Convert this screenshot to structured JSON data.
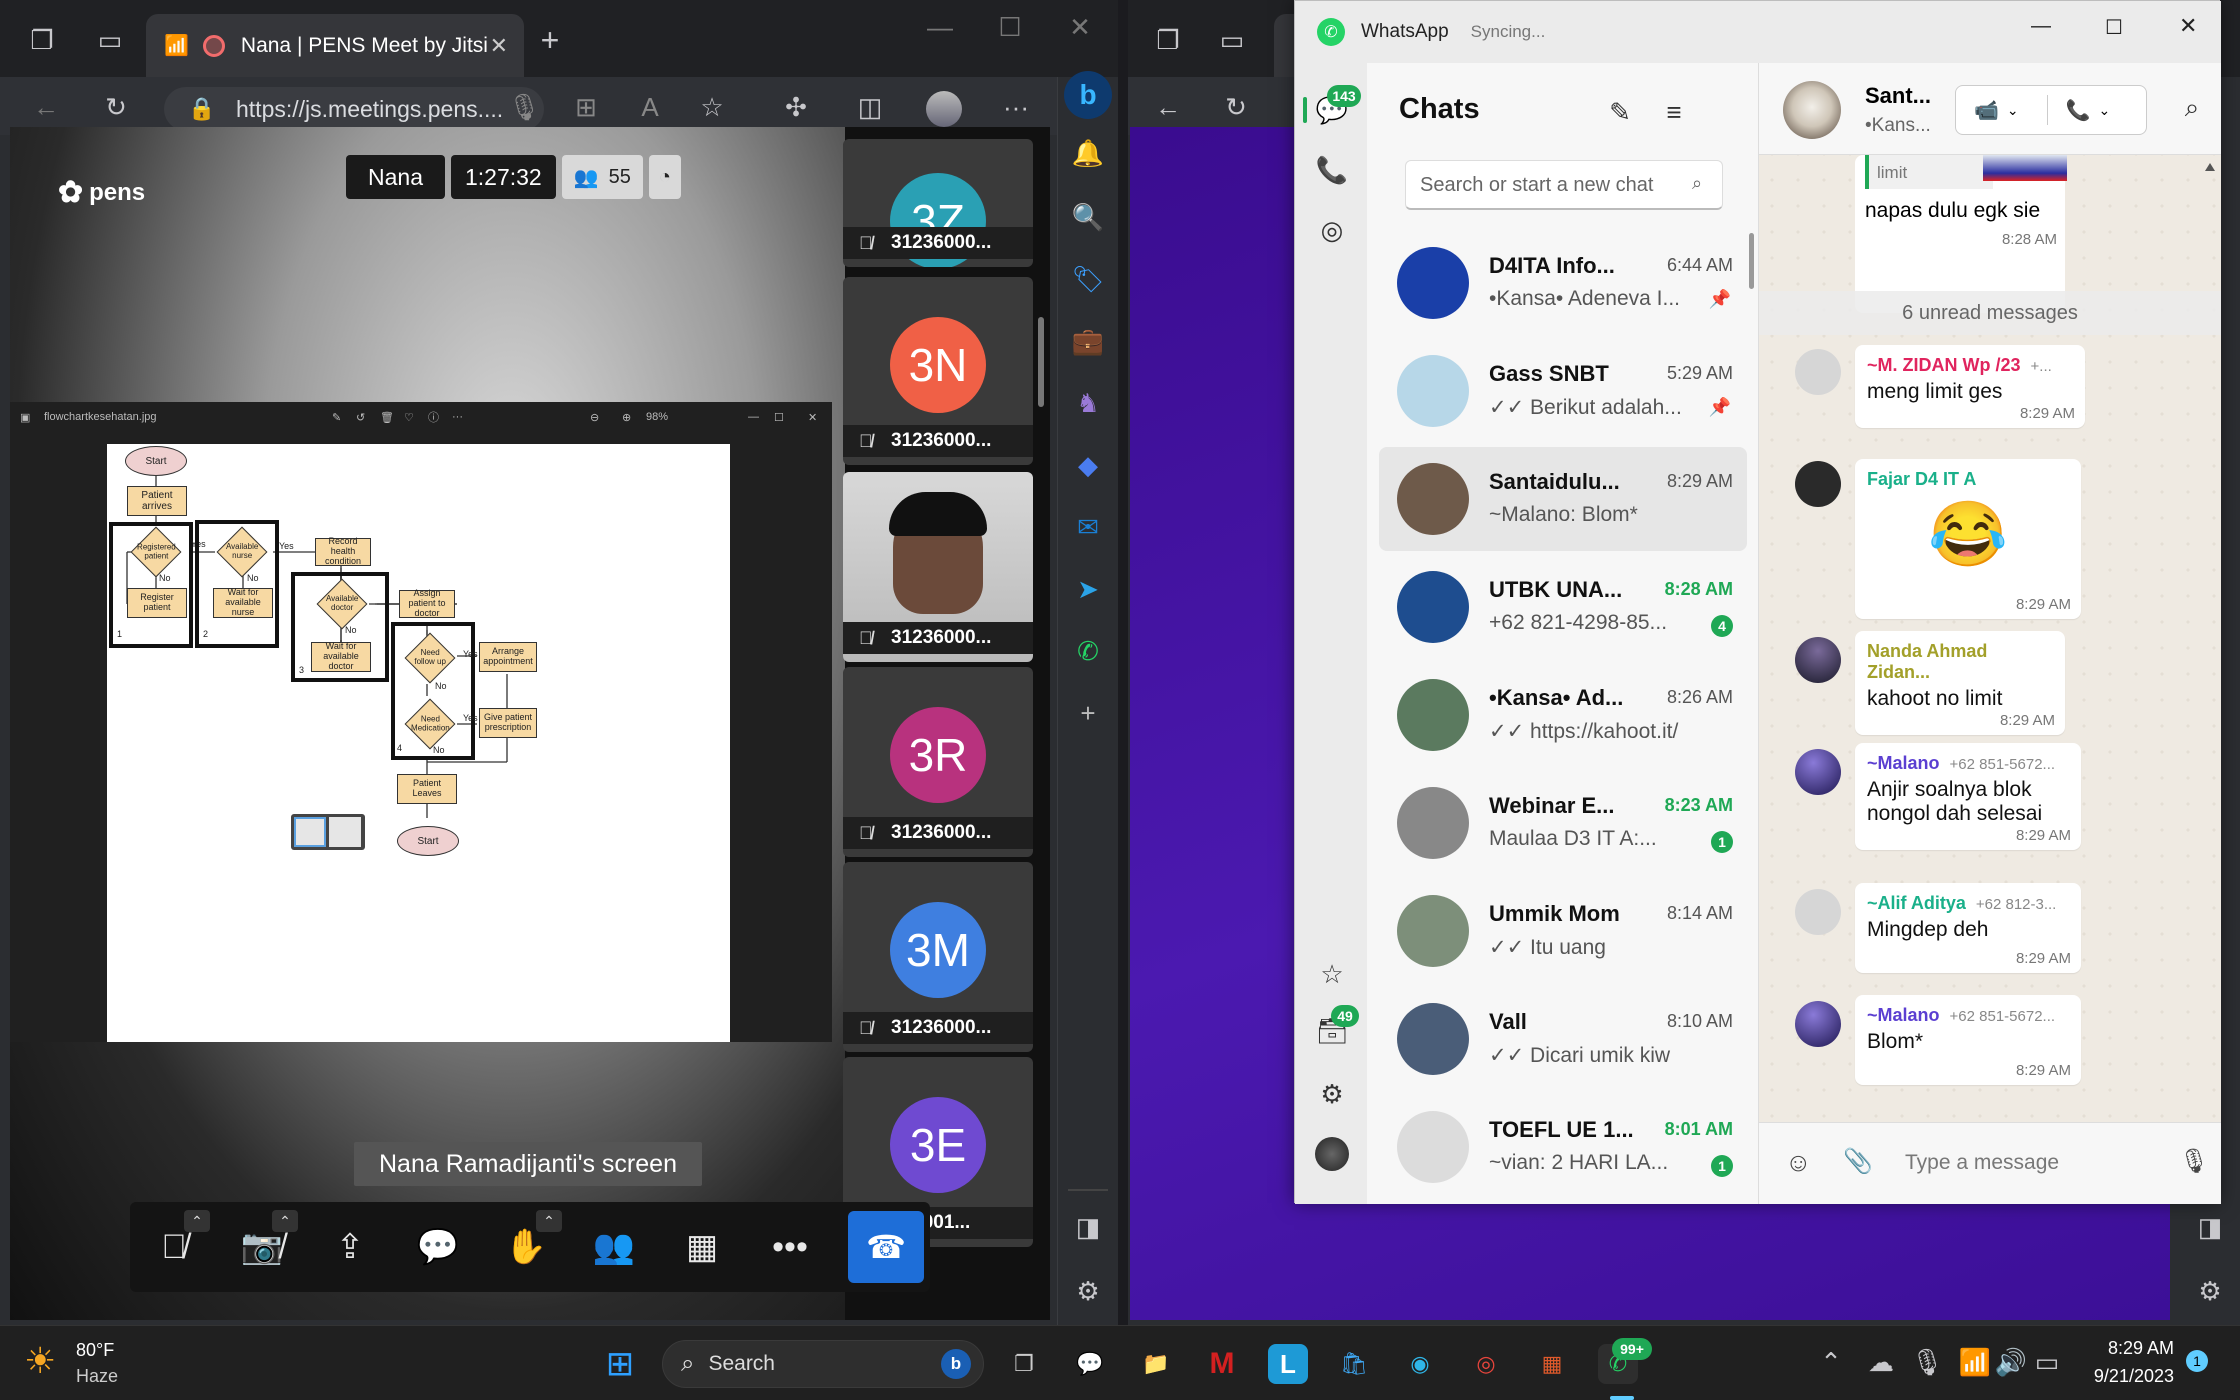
{
  "browser1": {
    "tab_title": "Nana | PENS Meet by Jitsi",
    "url": "https://js.meetings.pens....",
    "new_tab": "+"
  },
  "jitsi": {
    "logo": "pens",
    "presenter": "Nana",
    "duration": "1:27:32",
    "participants": "55",
    "screen_label": "Nana Ramadijanti's screen",
    "thumbnails": [
      {
        "initials": "3Z",
        "name": "31236000...",
        "color": "#2aa0b4"
      },
      {
        "initials": "3N",
        "name": "31236000...",
        "color": "#f06046"
      },
      {
        "initials": "",
        "name": "31236000...",
        "color": "#c6c6c6"
      },
      {
        "initials": "3R",
        "name": "31236000...",
        "color": "#b8327e"
      },
      {
        "initials": "3M",
        "name": "31236000...",
        "color": "#3f7fe0"
      },
      {
        "initials": "3E",
        "name": "230001...",
        "color": "#6f4ad1"
      }
    ]
  },
  "viewer": {
    "file_name": "flowchartkesehatan.jpg",
    "zoom": "98%"
  },
  "flowchart": {
    "start": "Start",
    "patient_arrives": "Patient arrives",
    "registered": "Registered patient",
    "register": "Register patient",
    "nurse": "Available nurse",
    "wait_nurse": "Wait for available nurse",
    "record": "Record health condition",
    "doctor": "Available doctor",
    "wait_doctor": "Wait for available doctor",
    "assign": "Assign patient to doctor",
    "follow": "Need follow up",
    "arrange": "Arrange appointment",
    "medication": "Need Medication",
    "prescription": "Give patient prescription",
    "leaves": "Patient Leaves",
    "end": "Start",
    "yes": "Yes",
    "no": "No",
    "g1": "1",
    "g2": "2",
    "g3": "3",
    "g4": "4"
  },
  "whatsapp": {
    "app_title": "WhatsApp",
    "status": "Syncing...",
    "chats_badge": "143",
    "archive_badge": "49",
    "chats_title": "Chats",
    "search_placeholder": "Search or start a new chat",
    "chats": [
      {
        "name": "D4ITA Info...",
        "time": "6:44 AM",
        "preview": "•Kansa• Adeneva I...",
        "color": "#1a3fa8",
        "unread": "",
        "pinned": true
      },
      {
        "name": "Gass SNBT",
        "time": "5:29 AM",
        "preview": "✓✓ Berikut adalah...",
        "color": "#b7d7e8",
        "unread": "",
        "pinned": true
      },
      {
        "name": "Santaidulu...",
        "time": "8:29 AM",
        "preview": "~Malano: Blom*",
        "color": "#6e5a4a",
        "unread": "",
        "pinned": false
      },
      {
        "name": "UTBK UNA...",
        "time": "8:28 AM",
        "preview": "+62 821-4298-85...",
        "color": "#1e4d8f",
        "unread": "4",
        "pinned": false
      },
      {
        "name": "•Kansa• Ad...",
        "time": "8:26 AM",
        "preview": "✓✓ https://kahoot.it/",
        "color": "#5b7a5f",
        "unread": "",
        "pinned": false
      },
      {
        "name": "Webinar E...",
        "time": "8:23 AM",
        "preview": "Maulaa D3 IT A:...",
        "color": "#888888",
        "unread": "1",
        "pinned": false
      },
      {
        "name": "Ummik Mom",
        "time": "8:14 AM",
        "preview": "✓✓ Itu uang",
        "color": "#7d8f7a",
        "unread": "",
        "pinned": false
      },
      {
        "name": "Vall",
        "time": "8:10 AM",
        "preview": "✓✓ Dicari umik kiw",
        "color": "#4a5d78",
        "unread": "",
        "pinned": false
      },
      {
        "name": "TOEFL UE 1...",
        "time": "8:01 AM",
        "preview": "~vian: 2 HARI LA...",
        "color": "#dcdcdc",
        "unread": "1",
        "pinned": false
      }
    ],
    "active_chat": {
      "name": "Sant...",
      "sub": "•Kans..."
    },
    "messages": {
      "quoted": "limit",
      "m0_text": "napas dulu egk sie",
      "m0_time": "8:28 AM",
      "unread_label": "6 unread messages",
      "m1_sender": "~M. ZIDAN Wp /23",
      "m1_phone": "+...",
      "m1_text": "meng limit ges",
      "m1_time": "8:29 AM",
      "m2_sender": "Fajar D4 IT A",
      "m2_text": "😂",
      "m2_time": "8:29 AM",
      "m3_sender": "Nanda Ahmad Zidan...",
      "m3_text": "kahoot no limit",
      "m3_time": "8:29 AM",
      "m4_sender": "~Malano",
      "m4_phone": "+62 851-5672...",
      "m4_text1": "Anjir soalnya blok",
      "m4_text2": "nongol dah selesai",
      "m4_time": "8:29 AM",
      "m5_sender": "~Alif Aditya",
      "m5_phone": "+62 812-3...",
      "m5_text": "Mingdep deh",
      "m5_time": "8:29 AM",
      "m6_sender": "~Malano",
      "m6_phone": "+62 851-5672...",
      "m6_text": "Blom*",
      "m6_time": "8:29 AM"
    },
    "composer_placeholder": "Type a message"
  },
  "taskbar": {
    "temp": "80°F",
    "weather": "Haze",
    "search": "Search",
    "wa_badge": "99+",
    "time": "8:29 AM",
    "date": "9/21/2023",
    "notif": "1"
  }
}
